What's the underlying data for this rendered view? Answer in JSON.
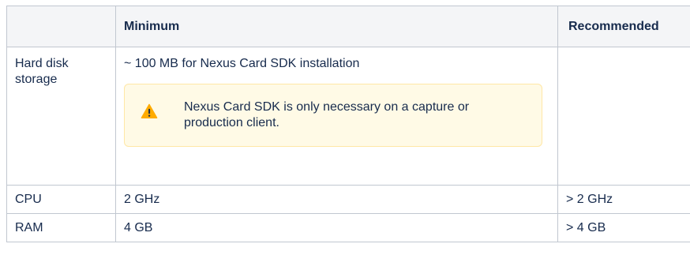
{
  "table": {
    "headers": [
      "",
      "Minimum",
      "Recommended"
    ],
    "rows": [
      {
        "label": "Hard disk storage",
        "minimum": "~ 100 MB for Nexus Card SDK installation",
        "recommended": "",
        "note": {
          "icon": "warning-icon",
          "color": "#ffab00",
          "text": "Nexus Card SDK is only necessary on a capture or production client."
        }
      },
      {
        "label": "CPU",
        "minimum": "2 GHz",
        "recommended": "> 2 GHz"
      },
      {
        "label": "RAM",
        "minimum": "4 GB",
        "recommended": "> 4 GB"
      }
    ]
  }
}
